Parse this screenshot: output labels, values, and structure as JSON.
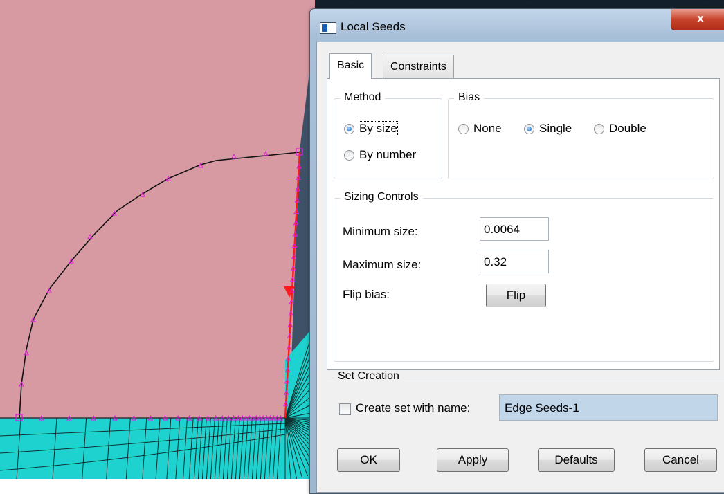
{
  "dialog": {
    "title": "Local Seeds",
    "close_glyph": "x",
    "tabs": [
      {
        "label": "Basic",
        "active": true
      },
      {
        "label": "Constraints",
        "active": false
      }
    ],
    "method": {
      "title": "Method",
      "options": [
        {
          "label": "By size",
          "selected": true
        },
        {
          "label": "By number",
          "selected": false
        }
      ]
    },
    "bias": {
      "title": "Bias",
      "options": [
        {
          "label": "None",
          "selected": false
        },
        {
          "label": "Single",
          "selected": true
        },
        {
          "label": "Double",
          "selected": false
        }
      ]
    },
    "sizing": {
      "title": "Sizing Controls",
      "min_label": "Minimum size:",
      "min_value": "0.0064",
      "max_label": "Maximum size:",
      "max_value": "0.32",
      "flip_label": "Flip bias:",
      "flip_button": "Flip"
    },
    "set_creation": {
      "title": "Set Creation",
      "checkbox_label": "Create set with name:",
      "checked": false,
      "name_value": "Edge Seeds-1"
    },
    "buttons": {
      "ok": "OK",
      "apply": "Apply",
      "defaults": "Defaults",
      "cancel": "Cancel"
    }
  },
  "viewport": {
    "part_color": "#d79aa3",
    "mesh_color": "#1ed3cf",
    "background_color": "#1d2c3c",
    "selected_edge_color": "#ff1a1a",
    "seed_color": "#e21be0"
  }
}
